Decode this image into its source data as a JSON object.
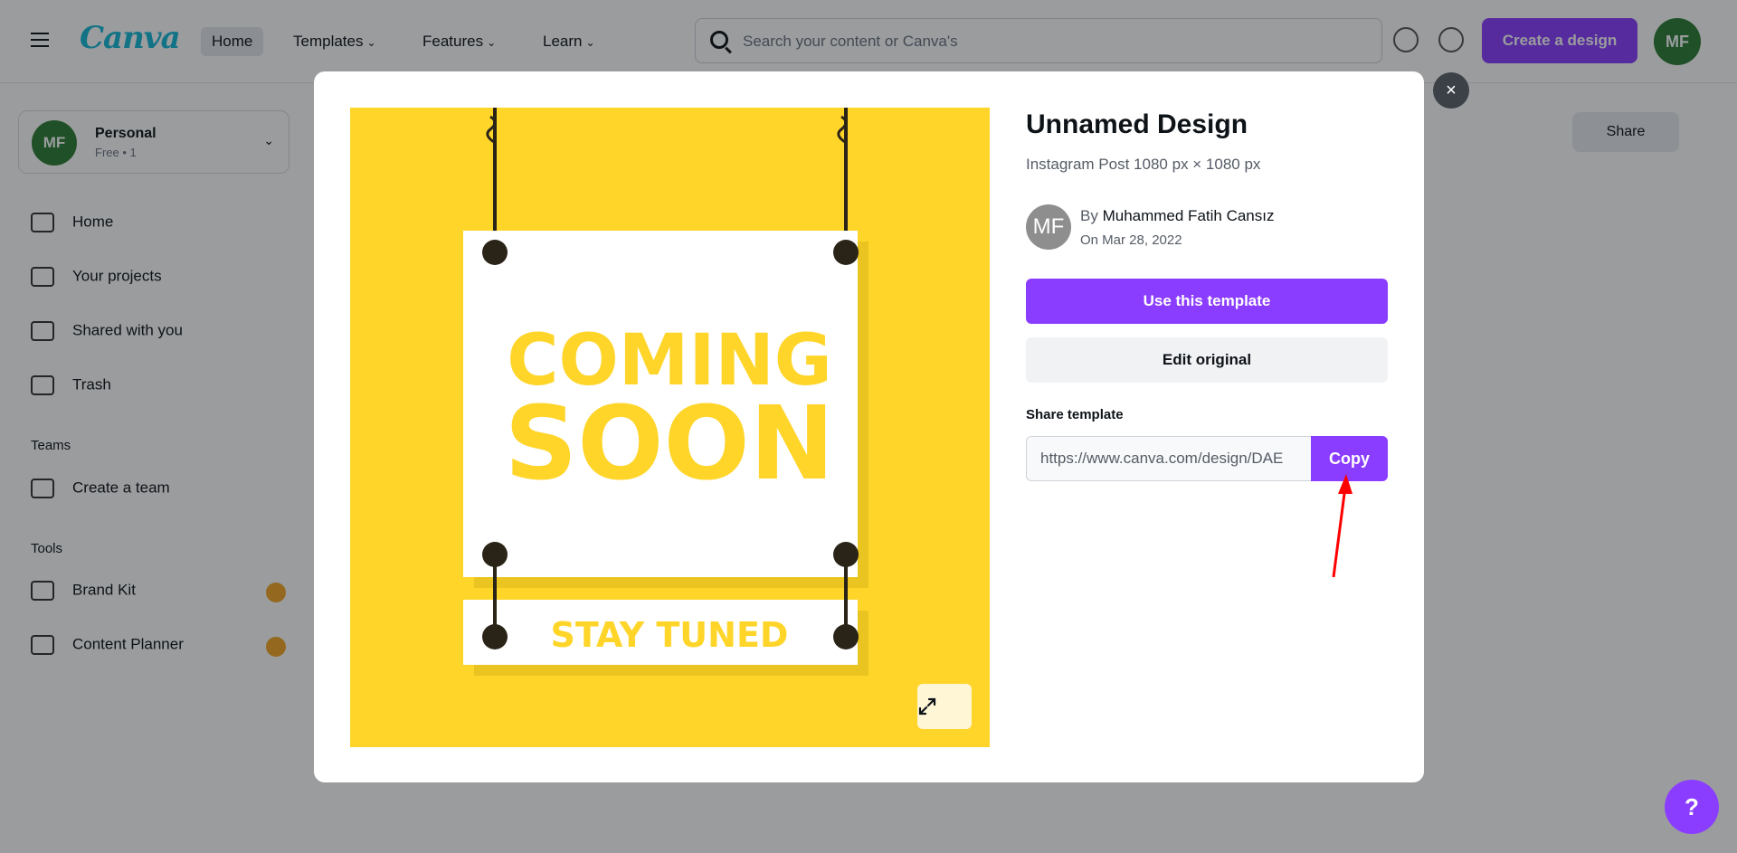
{
  "app": {
    "logo": "Canva",
    "nav": [
      {
        "label": "Home"
      },
      {
        "label": "Templates"
      },
      {
        "label": "Features"
      },
      {
        "label": "Learn"
      }
    ],
    "search_placeholder": "Search your content or Canva's",
    "create_label": "Create a design",
    "avatar_initials": "MF",
    "share_label": "Share"
  },
  "sidebar": {
    "team_name": "Personal",
    "team_sub": "Free • 1",
    "team_initials": "MF",
    "items": [
      {
        "label": "Home"
      },
      {
        "label": "Your projects"
      },
      {
        "label": "Shared with you"
      },
      {
        "label": "Trash"
      }
    ],
    "teams_header": "Teams",
    "create_team": "Create a team",
    "tools_header": "Tools",
    "tools": [
      {
        "label": "Brand Kit"
      },
      {
        "label": "Content Planner"
      }
    ]
  },
  "modal": {
    "title": "Unnamed Design",
    "subtitle": "Instagram Post 1080 px × 1080 px",
    "author_initials": "MF",
    "by_prefix": "By",
    "author_name": "Muhammed Fatih Cansız",
    "date": "On Mar 28, 2022",
    "use_template_label": "Use this template",
    "edit_original_label": "Edit original",
    "share_template_label": "Share template",
    "share_url": "https://www.canva.com/design/DAE",
    "copy_label": "Copy",
    "close_icon": "×"
  },
  "preview": {
    "line1": "COMING",
    "line2": "SOON",
    "line3": "STAY TUNED",
    "bg_color": "#ffd52a",
    "text_color": "#ffd52a"
  },
  "help_label": "?"
}
